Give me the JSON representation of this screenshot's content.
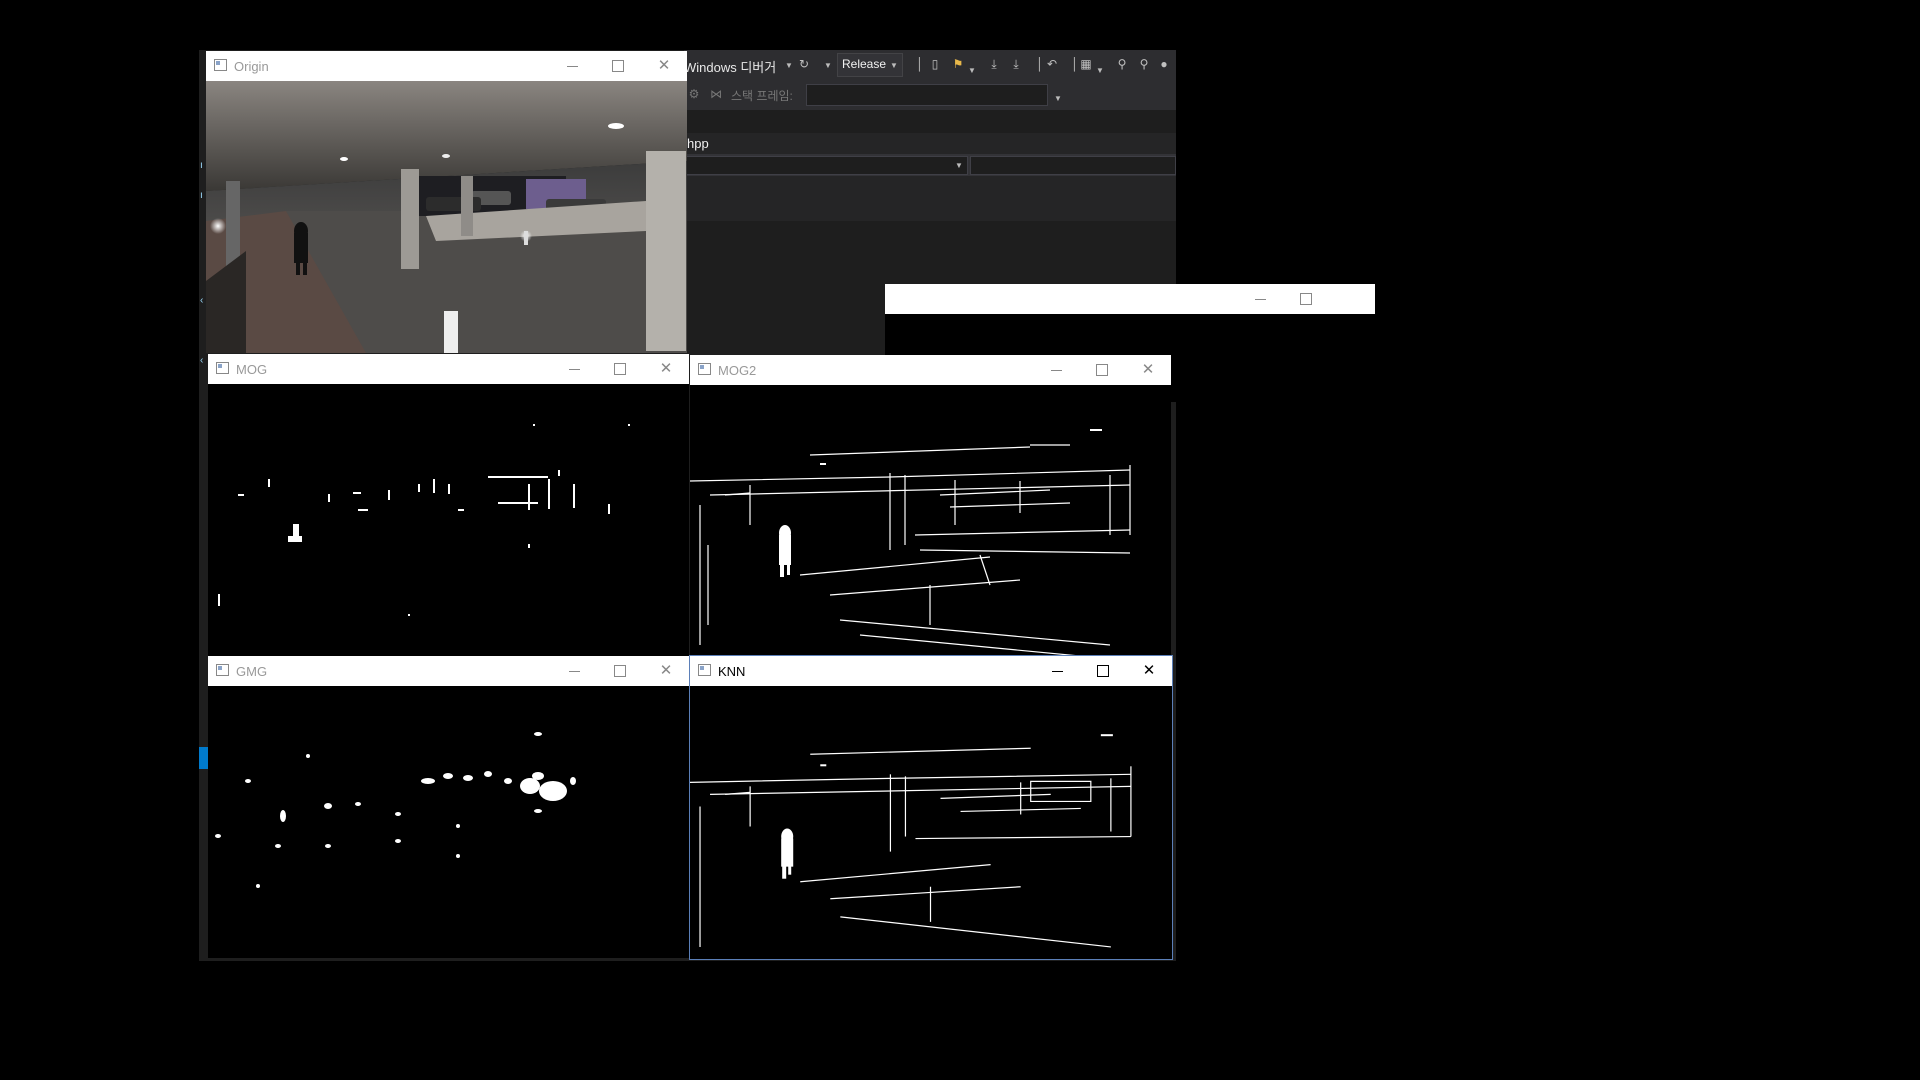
{
  "vs": {
    "debugger_label": "Windows 디버거",
    "config_label": "Release",
    "stack_frame_label": "스택 프레임:",
    "file_tab": "hpp"
  },
  "windows": {
    "origin": {
      "title": "Origin"
    },
    "mog": {
      "title": "MOG"
    },
    "mog2": {
      "title": "MOG2"
    },
    "gmg": {
      "title": "GMG"
    },
    "knn": {
      "title": "KNN"
    }
  },
  "colors": {
    "vs_bg": "#1e1e1e",
    "vs_toolbar": "#2d2d30",
    "titlebar": "#ffffff",
    "active_border": "#5b7fb8",
    "mask_fg": "#ffffff",
    "mask_bg": "#000000"
  }
}
